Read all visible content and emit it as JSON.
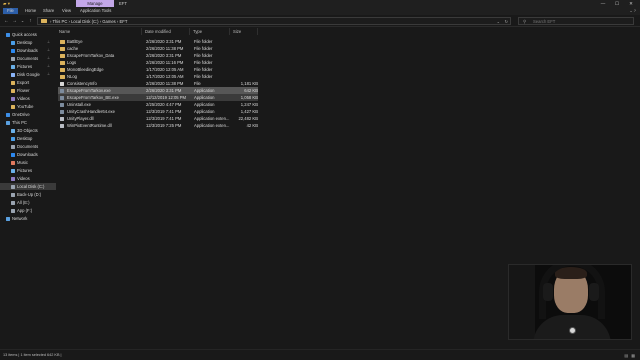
{
  "titlebar": {
    "manage_label": "Manage",
    "title": "EFT",
    "controls": [
      "—",
      "☐",
      "✕"
    ]
  },
  "ribbon": {
    "tabs": [
      "File",
      "Home",
      "Share",
      "View",
      "Application Tools"
    ],
    "right_icons": "⌄  ?"
  },
  "address": {
    "back": "←",
    "forward": "→",
    "recent": "⌄",
    "up": "↑",
    "crumbs": "›  This PC  ›  Local Disk (C:)  ›  Games  ›  EFT",
    "dropdown": "⌄",
    "refresh": "↻",
    "search_placeholder": "Search EFT",
    "search_icon": "⚲"
  },
  "nav": {
    "items": [
      {
        "label": "Quick access",
        "icon": "star-icon",
        "color": "#3d8ee6",
        "indent": 0,
        "pin": false
      },
      {
        "label": "Desktop",
        "icon": "desktop-icon",
        "color": "#4a9ee8",
        "indent": 1,
        "pin": true
      },
      {
        "label": "Downloads",
        "icon": "download-icon",
        "color": "#2d89ef",
        "indent": 1,
        "pin": true
      },
      {
        "label": "Documents",
        "icon": "document-icon",
        "color": "#9aa4b1",
        "indent": 1,
        "pin": true
      },
      {
        "label": "Pictures",
        "icon": "picture-icon",
        "color": "#6ab0e8",
        "indent": 1,
        "pin": true
      },
      {
        "label": "Disk Google",
        "icon": "drive-icon",
        "color": "#8ab4f8",
        "indent": 1,
        "pin": true
      },
      {
        "label": "Export",
        "icon": "folder-icon",
        "color": "#dcb35c",
        "indent": 1,
        "pin": false
      },
      {
        "label": "Flower",
        "icon": "folder-icon",
        "color": "#dcb35c",
        "indent": 1,
        "pin": false
      },
      {
        "label": "Videos",
        "icon": "video-icon",
        "color": "#8e7cc3",
        "indent": 1,
        "pin": false
      },
      {
        "label": "YouTube",
        "icon": "folder-icon",
        "color": "#dcb35c",
        "indent": 1,
        "pin": false
      },
      {
        "label": "OneDrive",
        "icon": "cloud-icon",
        "color": "#3d8ee6",
        "indent": 0,
        "pin": false
      },
      {
        "label": "This PC",
        "icon": "computer-icon",
        "color": "#5aa0e0",
        "indent": 0,
        "pin": false
      },
      {
        "label": "3D Objects",
        "icon": "cube-icon",
        "color": "#6ab0e8",
        "indent": 1,
        "pin": false
      },
      {
        "label": "Desktop",
        "icon": "desktop-icon",
        "color": "#4a9ee8",
        "indent": 1,
        "pin": false
      },
      {
        "label": "Documents",
        "icon": "document-icon",
        "color": "#9aa4b1",
        "indent": 1,
        "pin": false
      },
      {
        "label": "Downloads",
        "icon": "download-icon",
        "color": "#2d89ef",
        "indent": 1,
        "pin": false
      },
      {
        "label": "Music",
        "icon": "music-icon",
        "color": "#e07a5f",
        "indent": 1,
        "pin": false
      },
      {
        "label": "Pictures",
        "icon": "picture-icon",
        "color": "#6ab0e8",
        "indent": 1,
        "pin": false
      },
      {
        "label": "Videos",
        "icon": "video-icon",
        "color": "#8e7cc3",
        "indent": 1,
        "pin": false
      },
      {
        "label": "Local Disk (C:)",
        "icon": "disk-icon",
        "color": "#9aa4b1",
        "indent": 1,
        "pin": false,
        "selected": true
      },
      {
        "label": "Back-Up (D:)",
        "icon": "disk-icon",
        "color": "#9aa4b1",
        "indent": 1,
        "pin": false
      },
      {
        "label": "All (E:)",
        "icon": "disk-icon",
        "color": "#9aa4b1",
        "indent": 1,
        "pin": false
      },
      {
        "label": "App (F:)",
        "icon": "disk-icon",
        "color": "#9aa4b1",
        "indent": 1,
        "pin": false
      },
      {
        "label": "Network",
        "icon": "network-icon",
        "color": "#5aa0e0",
        "indent": 0,
        "pin": false
      }
    ]
  },
  "files": {
    "columns": [
      "Name",
      "Date modified",
      "Type",
      "Size"
    ],
    "rows": [
      {
        "name": "BattlEye",
        "date": "2/26/2020 3:31 PM",
        "type": "File folder",
        "size": "",
        "kind": "folder"
      },
      {
        "name": "cache",
        "date": "2/26/2020 11:38 PM",
        "type": "File folder",
        "size": "",
        "kind": "folder"
      },
      {
        "name": "EscapeFromTarkov_Data",
        "date": "2/26/2020 3:31 PM",
        "type": "File folder",
        "size": "",
        "kind": "folder"
      },
      {
        "name": "Logs",
        "date": "2/26/2020 11:16 PM",
        "type": "File folder",
        "size": "",
        "kind": "folder"
      },
      {
        "name": "MonoBleedingEdge",
        "date": "1/17/2020 12:05 AM",
        "type": "File folder",
        "size": "",
        "kind": "folder"
      },
      {
        "name": "NLog",
        "date": "1/17/2020 12:05 AM",
        "type": "File folder",
        "size": "",
        "kind": "folder"
      },
      {
        "name": "ConsistencyInfo",
        "date": "2/26/2020 11:38 PM",
        "type": "File",
        "size": "1,181 KB",
        "kind": "file"
      },
      {
        "name": "EscapeFromTarkov.exe",
        "date": "2/26/2020 3:31 PM",
        "type": "Application",
        "size": "642 KB",
        "kind": "exe",
        "state": "selected"
      },
      {
        "name": "EscapeFromTarkov_BE.exe",
        "date": "12/12/2019 12:05 PM",
        "type": "Application",
        "size": "1,058 KB",
        "kind": "exe",
        "state": "hover"
      },
      {
        "name": "Uninstall.exe",
        "date": "2/25/2020 4:47 PM",
        "type": "Application",
        "size": "1,247 KB",
        "kind": "exe"
      },
      {
        "name": "UnityCrashHandler64.exe",
        "date": "12/3/2019 7:41 PM",
        "type": "Application",
        "size": "1,427 KB",
        "kind": "exe"
      },
      {
        "name": "UnityPlayer.dll",
        "date": "12/3/2019 7:41 PM",
        "type": "Application exten...",
        "size": "22,482 KB",
        "kind": "dll"
      },
      {
        "name": "WinPixEventRuntime.dll",
        "date": "12/3/2019 7:25 PM",
        "type": "Application exten...",
        "size": "42 KB",
        "kind": "dll"
      }
    ]
  },
  "status": {
    "text": "13 items  |  1 item selected  642 KB  |",
    "view_icons": "▤ ▦"
  }
}
